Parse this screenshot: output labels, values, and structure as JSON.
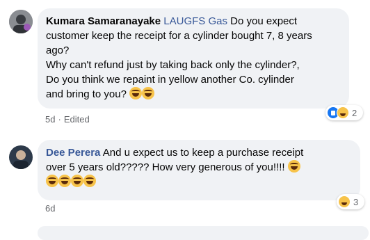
{
  "comments": [
    {
      "author": "Kumara Samaranayake",
      "mention": "LAUGFS Gas",
      "lines": [
        " Do you expect",
        "customer keep the receipt for a cylinder bought 7, 8 years",
        "ago?",
        "Why can't refund just by taking back only the cylinder?,",
        "Do you think we repaint in yellow another Co. cylinder",
        "and bring to you?"
      ],
      "time": "5d",
      "separator": "·",
      "edited": "Edited",
      "reaction_count": "2",
      "reaction_icons": [
        "like-icon",
        "haha-icon"
      ],
      "emoji_count_inline": 2
    },
    {
      "author": "Dee Perera",
      "lines": [
        " And u expect us to keep a purchase receipt",
        "over 5 years old????? How very generous of you!!!!"
      ],
      "time": "6d",
      "reaction_count": "3",
      "reaction_icons": [
        "haha-icon"
      ],
      "emoji_count_inline": 5
    }
  ]
}
